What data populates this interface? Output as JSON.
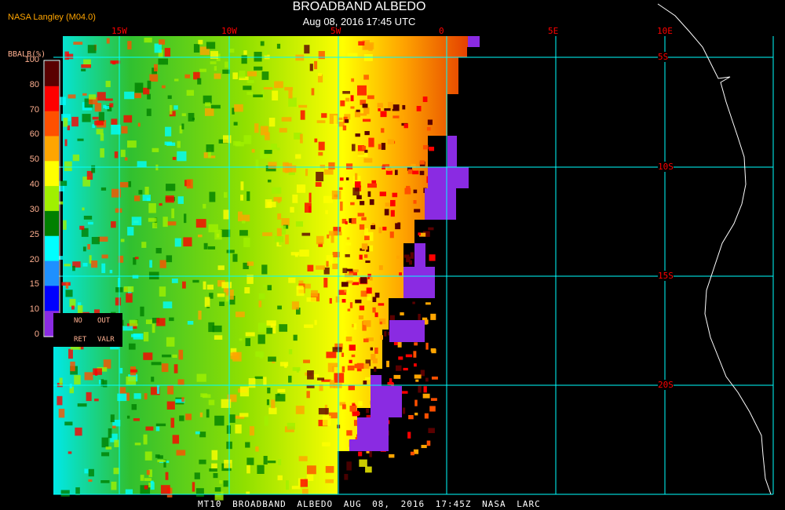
{
  "header": {
    "title": "BROADBAND ALBEDO",
    "subtitle": "Aug 08, 2016 17:45 UTC",
    "agency": "NASA Langley (M04.0)"
  },
  "legend": {
    "title": "BBALB(%)",
    "labels": [
      "100",
      "80",
      "70",
      "60",
      "50",
      "40",
      "30",
      "25",
      "20",
      "15",
      "10",
      "0"
    ],
    "colors": [
      "#5a0000",
      "#ff0000",
      "#ff5000",
      "#ffa500",
      "#ffff00",
      "#a0f000",
      "#008000",
      "#00ffff",
      "#1e90ff",
      "#0000ff",
      "#8a2be2"
    ],
    "no_retrieval": [
      "NO",
      "RET"
    ],
    "out_valid": [
      "OUT",
      "VALR"
    ]
  },
  "map": {
    "lon_labels": [
      "15W",
      "10W",
      "5W",
      "0",
      "5E",
      "10E"
    ],
    "lat_labels": [
      "5S",
      "10S",
      "15S",
      "20S"
    ],
    "grid_color": "#00ffff",
    "label_color": "#ff0000",
    "coast_color": "#ffffff"
  },
  "footer": "MT10  BROADBAND ALBEDO   AUG 08, 2016 17:45Z   NASA LARC"
}
